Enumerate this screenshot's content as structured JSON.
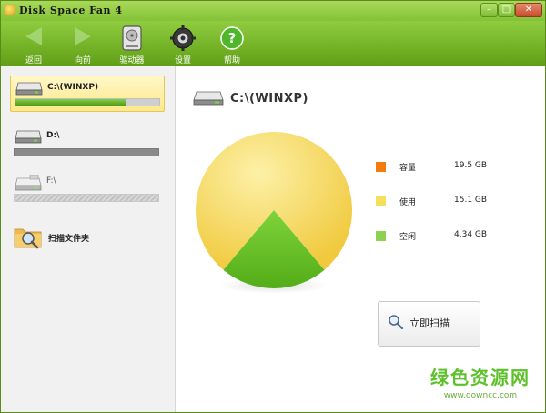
{
  "window": {
    "title": "Disk Space Fan 4"
  },
  "titlebar_buttons": {
    "minimize": "–",
    "maximize": "□",
    "close": "✕"
  },
  "toolbar": {
    "back": "返回",
    "forward": "向前",
    "drives": "驱动器",
    "settings": "设置",
    "help": "帮助"
  },
  "sidebar": {
    "drives": [
      {
        "name": "C:\\(WINXP)",
        "used_fraction": 0.77,
        "selected": true
      },
      {
        "name": "D:\\",
        "used_fraction": 0.0
      },
      {
        "name": "F:\\",
        "used_fraction": 0.0
      }
    ],
    "scan_folder": "扫描文件夹"
  },
  "main": {
    "drive_title": "C:\\(WINXP)",
    "legend": [
      {
        "label": "容量",
        "value": "19.5 GB",
        "color": "#f07d0c"
      },
      {
        "label": "使用",
        "value": "15.1 GB",
        "color": "#f7df5e"
      },
      {
        "label": "空闲",
        "value": "4.34 GB",
        "color": "#8ed04f"
      }
    ],
    "scan_button": "立即扫描"
  },
  "chart_data": {
    "type": "pie",
    "slices": [
      {
        "name": "使用",
        "value": 15.1,
        "color": "#f5d74a"
      },
      {
        "name": "空闲",
        "value": 4.34,
        "color": "#6cc22a"
      }
    ]
  },
  "watermark": {
    "text": "绿色资源网",
    "url": "www.downcc.com"
  }
}
